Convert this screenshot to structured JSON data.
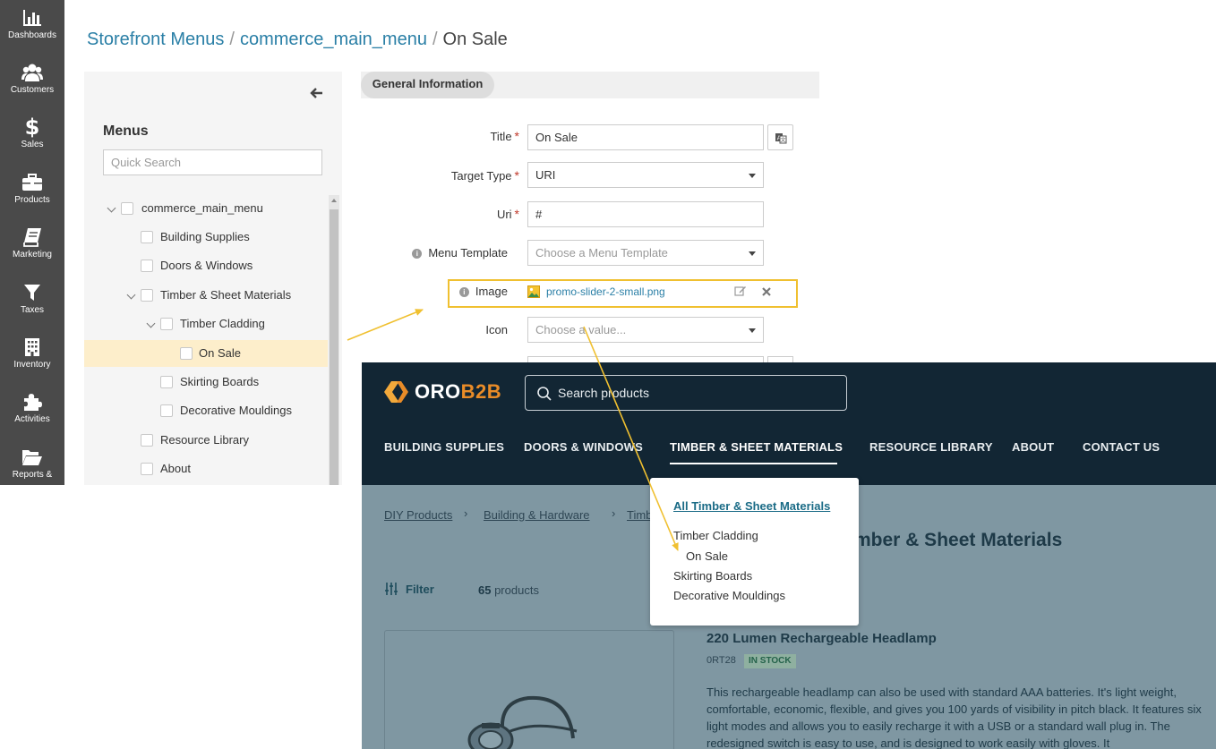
{
  "sidebar": {
    "items": [
      {
        "label": "Dashboards",
        "icon": "bar-chart-icon"
      },
      {
        "label": "Customers",
        "icon": "users-icon"
      },
      {
        "label": "Sales",
        "icon": "dollar-icon"
      },
      {
        "label": "Products",
        "icon": "briefcase-icon"
      },
      {
        "label": "Marketing",
        "icon": "book-icon"
      },
      {
        "label": "Taxes",
        "icon": "funnel-icon"
      },
      {
        "label": "Inventory",
        "icon": "building-icon"
      },
      {
        "label": "Activities",
        "icon": "puzzle-icon"
      },
      {
        "label": "Reports &",
        "icon": "folder-open-icon"
      }
    ]
  },
  "breadcrumb": {
    "root": "Storefront Menus",
    "menu": "commerce_main_menu",
    "current": "On Sale",
    "separator": "/"
  },
  "tree": {
    "heading": "Menus",
    "search_placeholder": "Quick Search",
    "items": [
      {
        "label": "commerce_main_menu"
      },
      {
        "label": "Building Supplies"
      },
      {
        "label": "Doors & Windows"
      },
      {
        "label": "Timber & Sheet Materials"
      },
      {
        "label": "Timber Cladding"
      },
      {
        "label": "On Sale"
      },
      {
        "label": "Skirting Boards"
      },
      {
        "label": "Decorative Mouldings"
      },
      {
        "label": "Resource Library"
      },
      {
        "label": "About"
      }
    ]
  },
  "form": {
    "tab_label": "General Information",
    "title_label": "Title",
    "title_value": "On Sale",
    "target_type_label": "Target Type",
    "target_type_value": "URI",
    "uri_label": "Uri",
    "uri_value": "#",
    "menu_template_label": "Menu Template",
    "menu_template_placeholder": "Choose a Menu Template",
    "image_label": "Image",
    "image_file": "promo-slider-2-small.png",
    "icon_label": "Icon",
    "icon_placeholder": "Choose a value...",
    "required_mark": "*",
    "info_mark": "i"
  },
  "storefront": {
    "logo_oro": "ORO",
    "logo_b2b": "B2B",
    "search_placeholder": "Search products",
    "nav": [
      "BUILDING SUPPLIES",
      "DOORS & WINDOWS",
      "TIMBER & SHEET MATERIALS",
      "RESOURCE LIBRARY",
      "ABOUT",
      "CONTACT US"
    ],
    "breadcrumbs": [
      "DIY Products",
      "Building & Hardware",
      "Timb"
    ],
    "category_title": "mber & Sheet Materials",
    "filter_label": "Filter",
    "product_count": "65",
    "product_count_suffix": " products",
    "product": {
      "title": "220 Lumen Rechargeable Headlamp",
      "sku": "0RT28",
      "stock": "IN STOCK",
      "description": "This rechargeable headlamp can also be used with standard AAA batteries. It's light weight, comfortable, economic, flexible, and gives you 100 yards of visibility in pitch black. It features six light modes and allows you to easily recharge it with a USB or a standard wall plug in. The redesigned switch is easy to use, and is designed to work easily with gloves. It"
    },
    "dropdown": {
      "all": "All Timber & Sheet Materials",
      "items": [
        "Timber Cladding",
        "On Sale",
        "Skirting Boards",
        "Decorative Mouldings"
      ]
    }
  },
  "colors": {
    "accent_link": "#2a7fa6",
    "highlight": "#f0c030",
    "sidebar_bg": "#4a4a4a",
    "store_header": "#122634",
    "selected_row": "#fdeecb"
  }
}
